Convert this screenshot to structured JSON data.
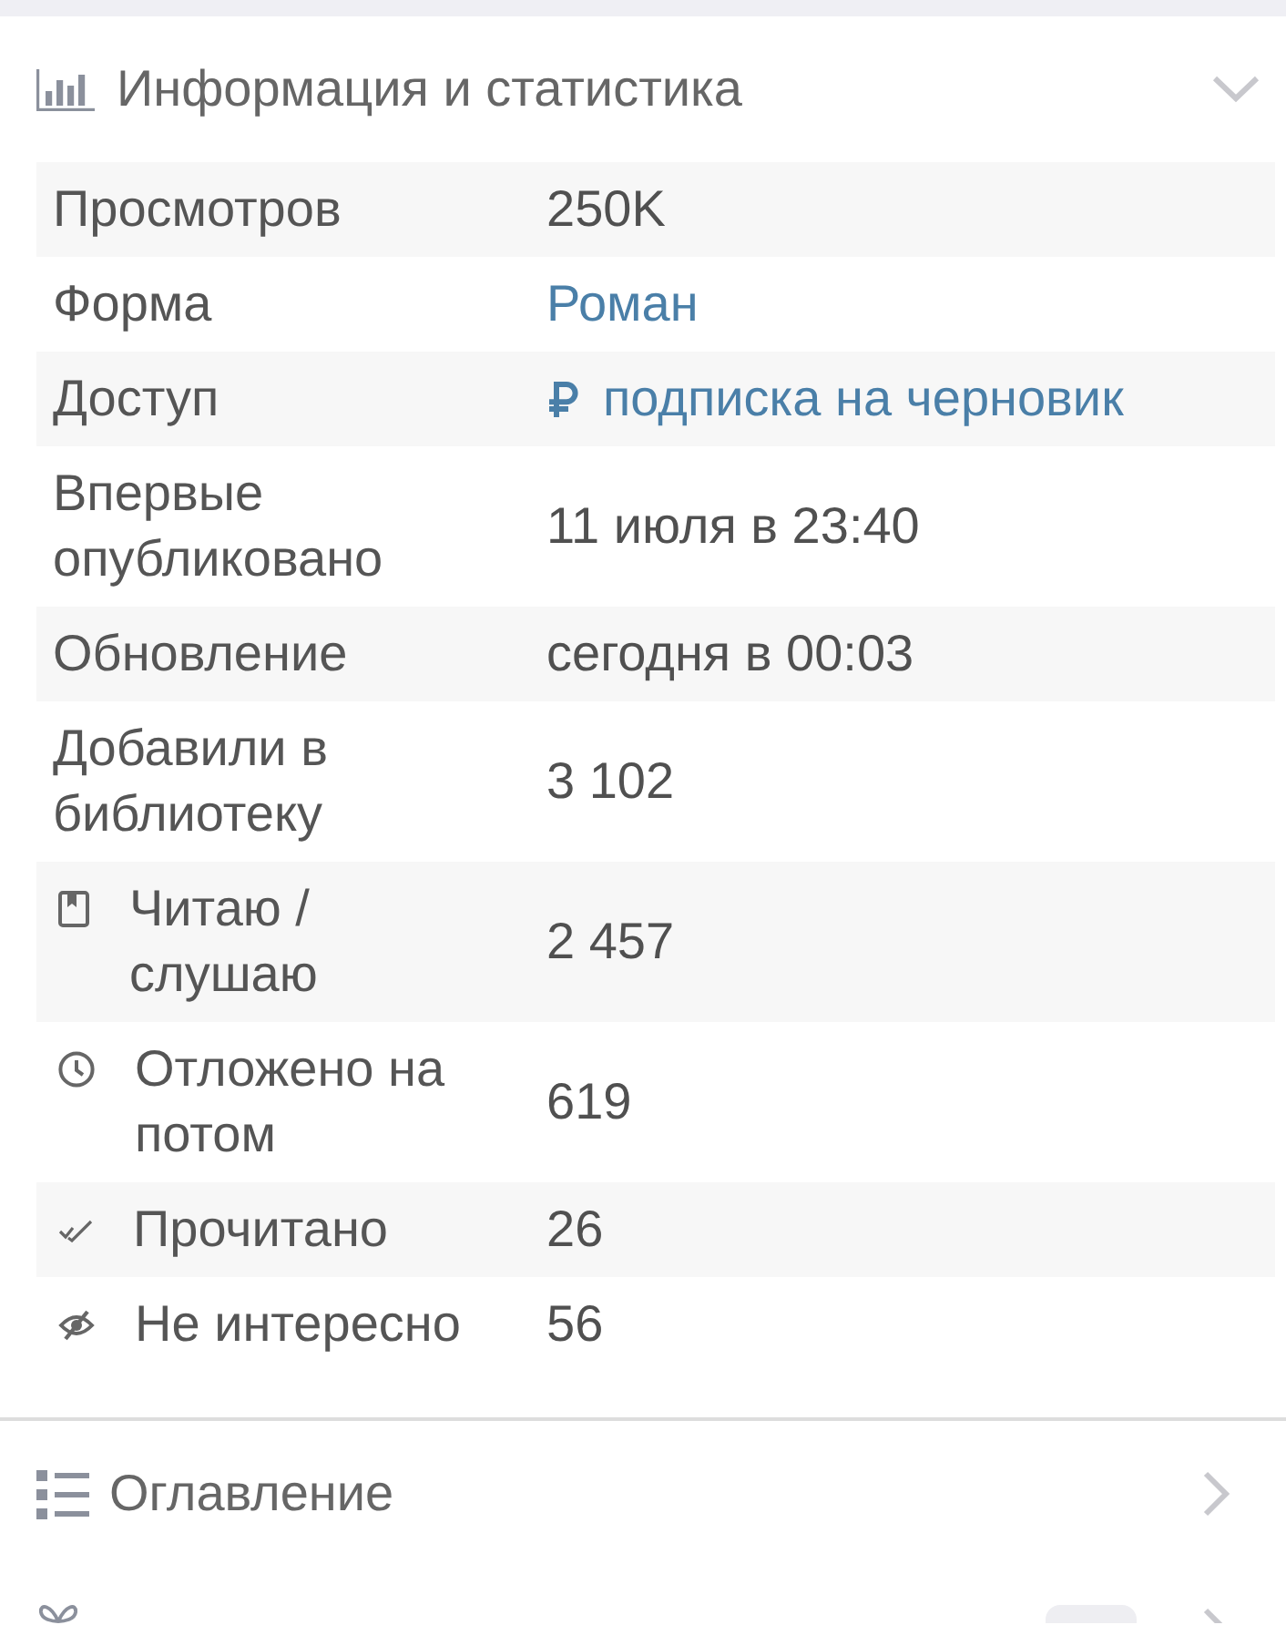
{
  "sections": [
    {
      "kind": "stats",
      "title": "Информация и статистика",
      "expanded": true,
      "rows": [
        {
          "kind": "plain",
          "label": "Просмотров",
          "value": "250K"
        },
        {
          "kind": "link",
          "label": "Форма",
          "value": "Роман"
        },
        {
          "kind": "paid",
          "label": "Доступ",
          "value": "подписка на черновик"
        },
        {
          "kind": "plain",
          "label": "Впервые опубликовано",
          "value": "11 июля в 23:40"
        },
        {
          "kind": "plain",
          "label": "Обновление",
          "value": "сегодня в 00:03"
        },
        {
          "kind": "plain",
          "label": "Добавили в библиотеку",
          "value": "3 102"
        },
        {
          "kind": "reading",
          "label": "Читаю / слушаю",
          "value": "2 457"
        },
        {
          "kind": "deferred",
          "label": "Отложено на потом",
          "value": "619"
        },
        {
          "kind": "finished",
          "label": "Прочитано",
          "value": "26"
        },
        {
          "kind": "ignored",
          "label": "Не интересно",
          "value": "56"
        }
      ]
    },
    {
      "kind": "contents",
      "title": "Оглавление",
      "expanded": false
    },
    {
      "kind": "rewards",
      "expanded": false
    }
  ]
}
